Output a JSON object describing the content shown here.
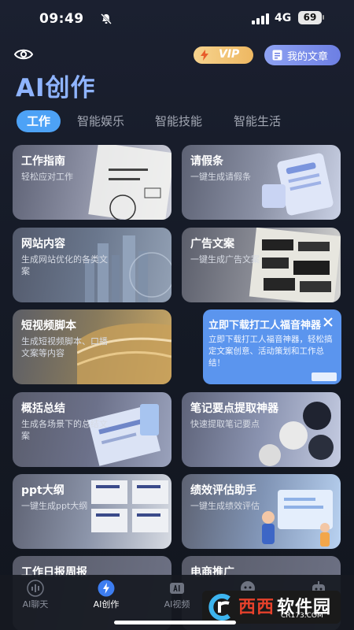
{
  "status_bar": {
    "time": "09:49",
    "network": "4G",
    "battery": "69"
  },
  "header": {
    "vip_label": "VIP",
    "my_articles_label": "我的文章",
    "title": "AI创作"
  },
  "tabs": [
    {
      "label": "工作",
      "active": true
    },
    {
      "label": "智能娱乐",
      "active": false
    },
    {
      "label": "智能技能",
      "active": false
    },
    {
      "label": "智能生活",
      "active": false
    }
  ],
  "cards": [
    {
      "title": "工作指南",
      "desc": "轻松应对工作"
    },
    {
      "title": "请假条",
      "desc": "一键生成请假条"
    },
    {
      "title": "网站内容",
      "desc": "生成网站优化的各类文案"
    },
    {
      "title": "广告文案",
      "desc": "一键生成广告文案"
    },
    {
      "title": "短视频脚本",
      "desc": "生成短视频脚本、口播文案等内容"
    },
    {
      "title": "概括总结",
      "desc": "生成各场景下的总结文案"
    },
    {
      "title": "笔记要点提取神器",
      "desc": "快速提取笔记要点"
    },
    {
      "title": "ppt大纲",
      "desc": "一键生成ppt大纲"
    },
    {
      "title": "绩效评估助手",
      "desc": "一键生成绩效评估"
    },
    {
      "title": "工作日报周报",
      "desc": ""
    },
    {
      "title": "电商推广",
      "desc": ""
    }
  ],
  "ad": {
    "title": "立即下载打工人福音神器",
    "desc": "立即下载打工人福音神器，轻松搞定文案创意、活动策划和工作总结！"
  },
  "bottom_nav": [
    {
      "label": "AI聊天",
      "icon": "chat-wave-icon"
    },
    {
      "label": "AI创作",
      "icon": "bolt-icon",
      "active": true
    },
    {
      "label": "AI视频",
      "icon": "ai-video-icon"
    },
    {
      "label": "",
      "icon": "game-icon"
    },
    {
      "label": "",
      "icon": "robot-icon"
    }
  ],
  "watermark": {
    "brand": "西西软件园",
    "brand_part1": "西西",
    "brand_part2": "软件园",
    "url": "CR173.COM"
  },
  "colors": {
    "accent": "#4da2f6",
    "title": "#8fb4ff",
    "vip": "#eeb862",
    "ad_bg": "#5b95ee"
  }
}
